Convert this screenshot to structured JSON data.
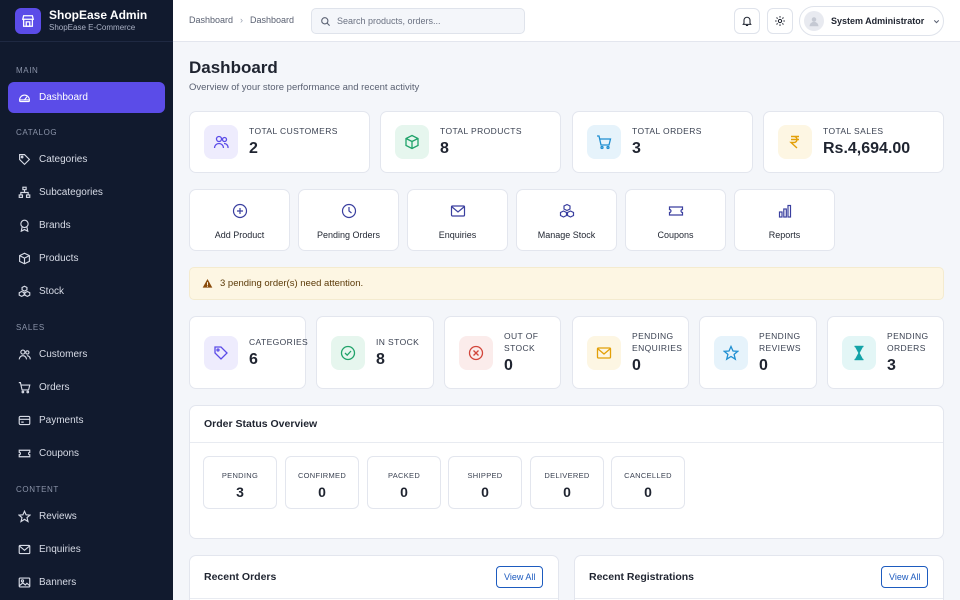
{
  "brand": {
    "title": "ShopEase Admin",
    "subtitle": "ShopEase E-Commerce",
    "accent": "#5b4ce8"
  },
  "sidebar": {
    "sections": {
      "main": "MAIN",
      "catalog": "CATALOG",
      "sales": "SALES",
      "content": "CONTENT"
    },
    "items": [
      {
        "label": "Dashboard",
        "icon": "dashboard-icon",
        "active": true
      },
      {
        "label": "Categories",
        "icon": "tag-icon"
      },
      {
        "label": "Subcategories",
        "icon": "sitemap-icon"
      },
      {
        "label": "Brands",
        "icon": "award-icon"
      },
      {
        "label": "Products",
        "icon": "box-icon"
      },
      {
        "label": "Stock",
        "icon": "cubes-icon"
      },
      {
        "label": "Customers",
        "icon": "users-icon"
      },
      {
        "label": "Orders",
        "icon": "cart-icon"
      },
      {
        "label": "Payments",
        "icon": "card-icon"
      },
      {
        "label": "Coupons",
        "icon": "ticket-icon"
      },
      {
        "label": "Reviews",
        "icon": "star-icon"
      },
      {
        "label": "Enquiries",
        "icon": "mail-icon"
      },
      {
        "label": "Banners",
        "icon": "image-icon"
      }
    ]
  },
  "topbar": {
    "breadcrumb": [
      "Dashboard",
      "Dashboard"
    ],
    "search_placeholder": "Search products, orders...",
    "user_name": "System Administrator"
  },
  "page": {
    "title": "Dashboard",
    "subtitle": "Overview of your store performance and recent activity"
  },
  "stats": [
    {
      "label": "TOTAL CUSTOMERS",
      "value": "2",
      "icon": "users-icon",
      "color": "#5b4ce8",
      "bg": "#eeecfd"
    },
    {
      "label": "TOTAL PRODUCTS",
      "value": "8",
      "icon": "box-icon",
      "color": "#20a36a",
      "bg": "#e6f6ee"
    },
    {
      "label": "TOTAL ORDERS",
      "value": "3",
      "icon": "cart-icon",
      "color": "#1f8fd1",
      "bg": "#e6f3fb"
    },
    {
      "label": "TOTAL SALES",
      "value": "Rs.4,694.00",
      "icon": "rupee-icon",
      "color": "#e3a008",
      "bg": "#fdf6e3"
    }
  ],
  "quick_actions": [
    {
      "label": "Add Product",
      "icon": "plus-circle-icon"
    },
    {
      "label": "Pending Orders",
      "icon": "clock-icon"
    },
    {
      "label": "Enquiries",
      "icon": "mail-icon"
    },
    {
      "label": "Manage Stock",
      "icon": "cubes-icon"
    },
    {
      "label": "Coupons",
      "icon": "ticket-icon"
    },
    {
      "label": "Reports",
      "icon": "bar-chart-icon"
    }
  ],
  "alert": {
    "text": "3 pending order(s) need attention."
  },
  "mini_stats": [
    {
      "label_lines": [
        "CATEGORIES"
      ],
      "value": "6",
      "icon": "tag-icon",
      "color": "#5b4ce8",
      "bg": "#eeecfd"
    },
    {
      "label_lines": [
        "IN STOCK"
      ],
      "value": "8",
      "icon": "check-circle-icon",
      "color": "#20a36a",
      "bg": "#e6f6ee"
    },
    {
      "label_lines": [
        "OUT OF",
        "STOCK"
      ],
      "value": "0",
      "icon": "x-circle-icon",
      "color": "#d2453a",
      "bg": "#fbeceb"
    },
    {
      "label_lines": [
        "PENDING",
        "ENQUIRIES"
      ],
      "value": "0",
      "icon": "mail-icon",
      "color": "#e3a008",
      "bg": "#fdf6e3"
    },
    {
      "label_lines": [
        "PENDING",
        "REVIEWS"
      ],
      "value": "0",
      "icon": "star-icon",
      "color": "#1f8fd1",
      "bg": "#e6f3fb"
    },
    {
      "label_lines": [
        "PENDING",
        "ORDERS"
      ],
      "value": "3",
      "icon": "hourglass-icon",
      "color": "#14a3a8",
      "bg": "#e3f6f6"
    }
  ],
  "order_status": {
    "title": "Order Status Overview",
    "items": [
      {
        "label": "PENDING",
        "value": "3"
      },
      {
        "label": "CONFIRMED",
        "value": "0"
      },
      {
        "label": "PACKED",
        "value": "0"
      },
      {
        "label": "SHIPPED",
        "value": "0"
      },
      {
        "label": "DELIVERED",
        "value": "0"
      },
      {
        "label": "CANCELLED",
        "value": "0"
      }
    ]
  },
  "recent_orders": {
    "title": "Recent Orders",
    "view_all": "View All"
  },
  "recent_registrations": {
    "title": "Recent Registrations",
    "view_all": "View All"
  }
}
